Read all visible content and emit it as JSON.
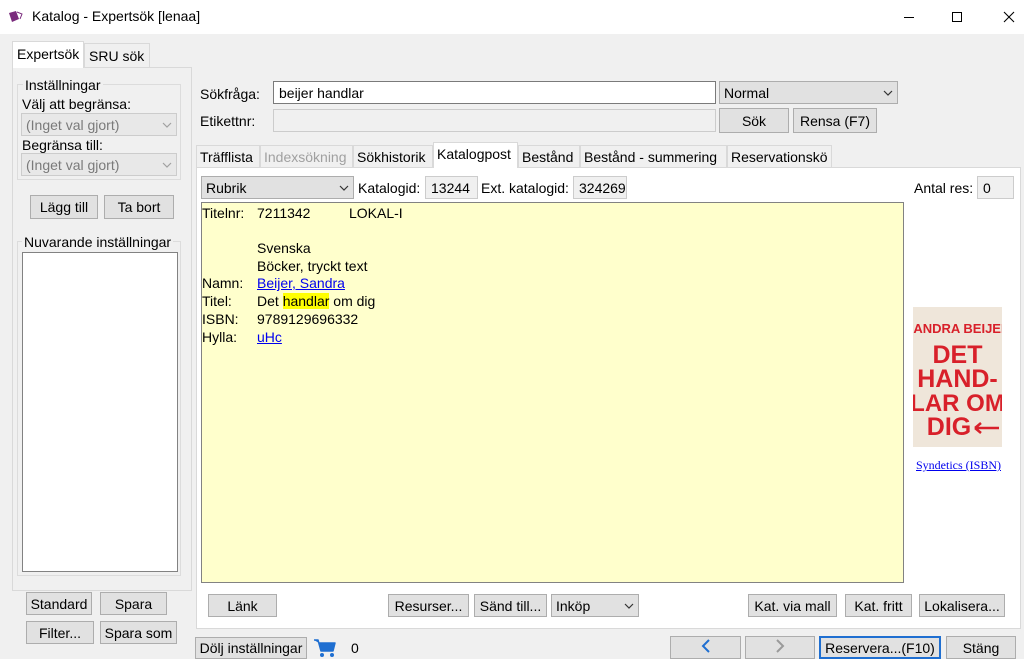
{
  "window": {
    "title": "Katalog - Expertsök [lenaa]",
    "minimize_icon": "minimize-icon",
    "maximize_icon": "maximize-icon",
    "close_icon": "close-icon"
  },
  "top_tabs": [
    {
      "label": "Expertsök",
      "active": true
    },
    {
      "label": "SRU sök",
      "active": false
    }
  ],
  "settings": {
    "group_title": "Inställningar",
    "limit_label": "Välj att begränsa:",
    "limit_value": "(Inget val gjort)",
    "restrict_label": "Begränsa till:",
    "restrict_value": "(Inget val gjort)",
    "add_button": "Lägg till",
    "remove_button": "Ta bort",
    "current_title": "Nuvarande inställningar",
    "standard_button": "Standard",
    "save_button": "Spara",
    "filter_button": "Filter...",
    "save_as_button": "Spara som"
  },
  "search": {
    "query_label": "Sökfråga:",
    "query_value": "beijer handlar",
    "mode_value": "Normal",
    "label_no_label": "Etikettnr:",
    "label_no_value": "",
    "search_button": "Sök",
    "clear_button": "Rensa (F7)"
  },
  "sub_tabs": [
    {
      "label": "Träfflista",
      "state": "normal"
    },
    {
      "label": "Indexsökning",
      "state": "disabled"
    },
    {
      "label": "Sökhistorik",
      "state": "normal"
    },
    {
      "label": "Katalogpost",
      "state": "active"
    },
    {
      "label": "Bestånd",
      "state": "normal"
    },
    {
      "label": "Bestånd - summering",
      "state": "normal"
    },
    {
      "label": "Reservationskö",
      "state": "normal"
    }
  ],
  "record_header": {
    "view_value": "Rubrik",
    "catalog_id_label": "Katalogid:",
    "catalog_id_value": "13244",
    "ext_catalog_id_label": "Ext. katalogid:",
    "ext_catalog_id_value": "324269",
    "reservations_label": "Antal res:",
    "reservations_value": "0"
  },
  "record": {
    "title_no_key": "Titelnr:",
    "title_no_value": "7211342",
    "title_no_extra": "LOKAL-I",
    "language": "Svenska",
    "media_type": "Böcker, tryckt text",
    "name_key": "Namn:",
    "name_value": "Beijer, Sandra",
    "title_key": "Titel:",
    "title_before": "Det ",
    "title_highlight": "handlar",
    "title_after": " om dig",
    "isbn_key": "ISBN:",
    "isbn_value": "9789129696332",
    "shelf_key": "Hylla:",
    "shelf_value": "uHc"
  },
  "cover": {
    "author_text": "SANDRA BEIJER",
    "title_text": "DET HANDLAR OM DIG",
    "source_link": "Syndetics (ISBN)",
    "bg_color": "#efe6da",
    "ink_color": "#d8202a"
  },
  "record_actions": {
    "link_button": "Länk",
    "resources_button": "Resurser...",
    "send_to_button": "Sänd till...",
    "purchase_value": "Inköp",
    "cat_template_button": "Kat. via mall",
    "cat_free_button": "Kat. fritt",
    "localize_button": "Lokalisera..."
  },
  "footer": {
    "hide_settings_button": "Dölj inställningar",
    "cart_count": "0",
    "reserve_button": "Reservera...(F10)",
    "close_button": "Stäng",
    "accent_color": "#1f6fd1"
  }
}
